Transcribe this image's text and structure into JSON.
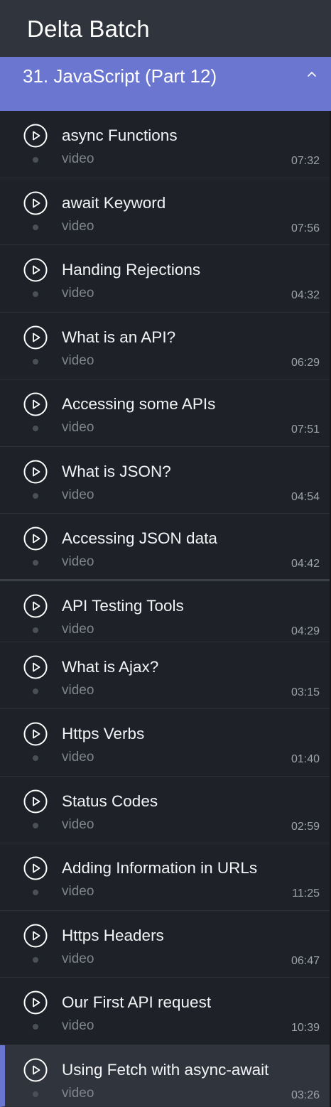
{
  "header": {
    "title": "Delta Batch"
  },
  "section": {
    "title": "31. JavaScript (Part 12)",
    "expanded": true,
    "chevron_icon": "chevron-up-icon"
  },
  "colors": {
    "accent": "#6a76d0",
    "background": "#1e2127",
    "header_bg": "#30343c"
  },
  "lessons": [
    {
      "title": "async Functions",
      "type": "video",
      "duration": "07:32",
      "icon": "play-circle-icon"
    },
    {
      "title": "await Keyword",
      "type": "video",
      "duration": "07:56",
      "icon": "play-circle-icon"
    },
    {
      "title": "Handing Rejections",
      "type": "video",
      "duration": "04:32",
      "icon": "play-circle-icon"
    },
    {
      "title": "What is an API?",
      "type": "video",
      "duration": "06:29",
      "icon": "play-circle-icon"
    },
    {
      "title": "Accessing some APIs",
      "type": "video",
      "duration": "07:51",
      "icon": "play-circle-icon"
    },
    {
      "title": "What is JSON?",
      "type": "video",
      "duration": "04:54",
      "icon": "play-circle-icon"
    },
    {
      "title": "Accessing JSON data",
      "type": "video",
      "duration": "04:42",
      "icon": "play-circle-icon"
    },
    {
      "title": "API Testing Tools",
      "type": "video",
      "duration": "04:29",
      "icon": "play-circle-icon"
    },
    {
      "title": "What is Ajax?",
      "type": "video",
      "duration": "03:15",
      "icon": "play-circle-icon"
    },
    {
      "title": "Https Verbs",
      "type": "video",
      "duration": "01:40",
      "icon": "play-circle-icon"
    },
    {
      "title": "Status Codes",
      "type": "video",
      "duration": "02:59",
      "icon": "play-circle-icon"
    },
    {
      "title": "Adding Information in URLs",
      "type": "video",
      "duration": "11:25",
      "icon": "play-circle-icon"
    },
    {
      "title": "Https Headers",
      "type": "video",
      "duration": "06:47",
      "icon": "play-circle-icon"
    },
    {
      "title": "Our First API request",
      "type": "video",
      "duration": "10:39",
      "icon": "play-circle-icon"
    },
    {
      "title": "Using Fetch with async-await",
      "type": "video",
      "duration": "03:26",
      "icon": "play-circle-icon",
      "active": true
    }
  ]
}
